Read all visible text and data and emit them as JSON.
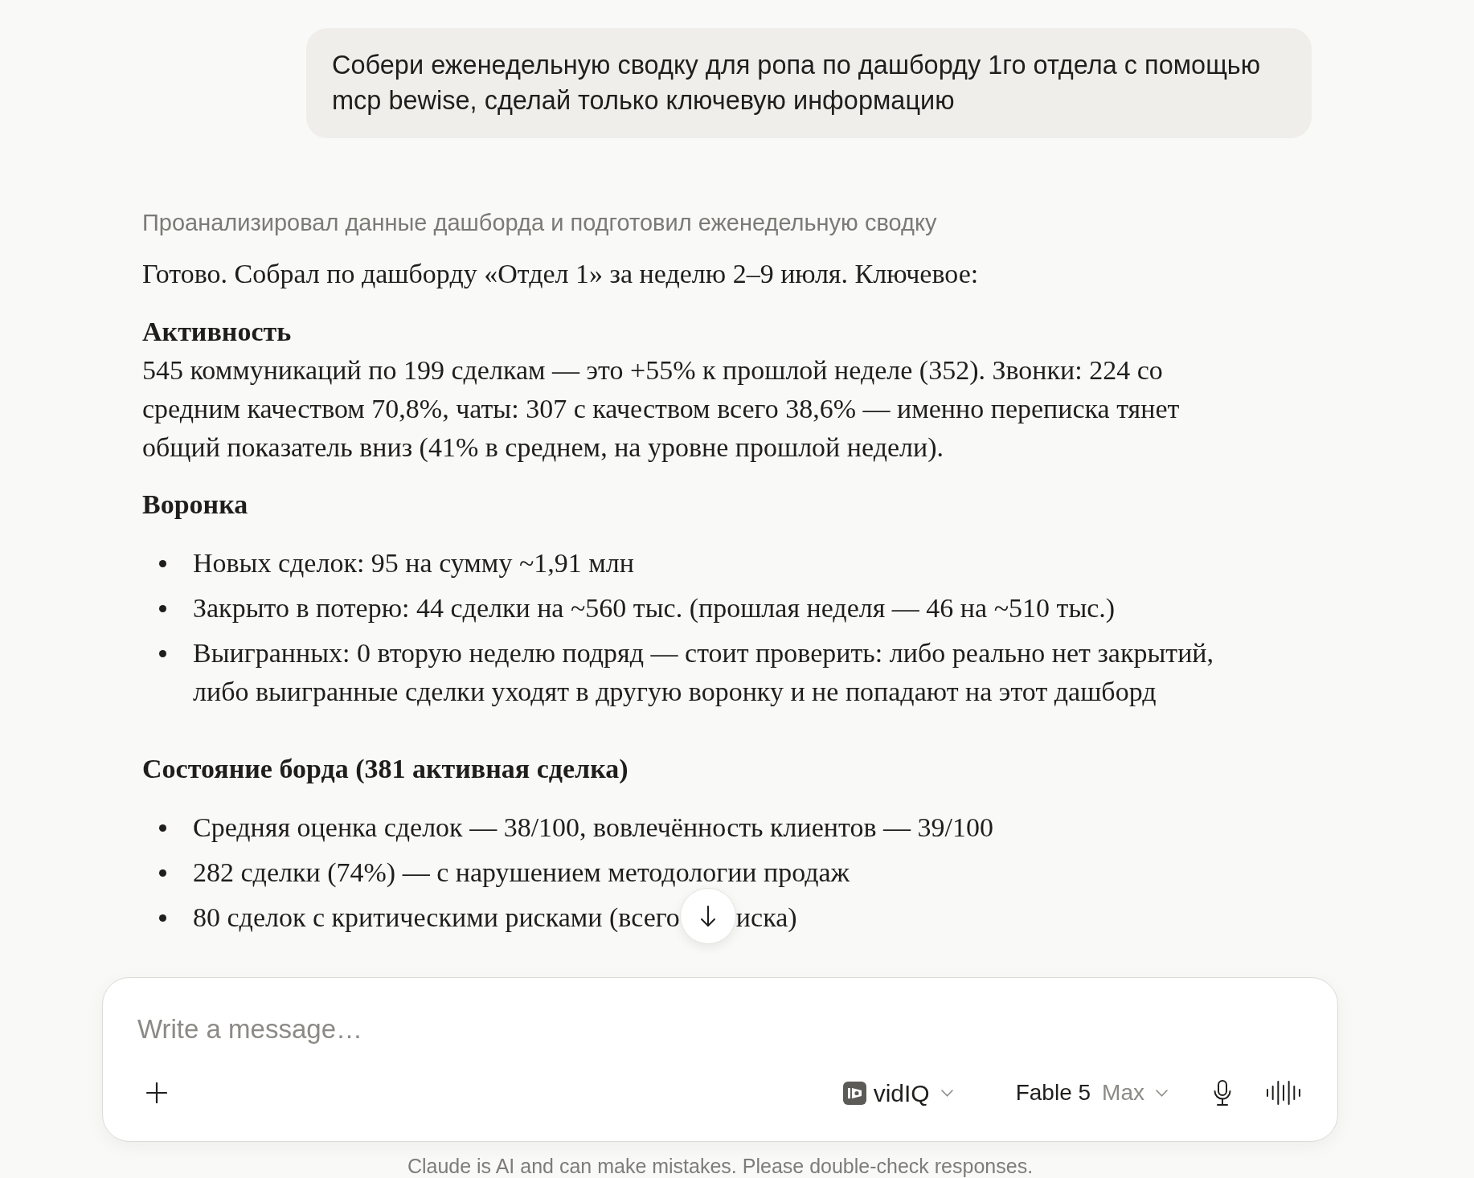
{
  "user_message": {
    "text": "Собери еженедельную сводку для ропа по дашборду 1го отдела с помощью mcp bewise, сделай только ключевую информацию"
  },
  "response": {
    "status": "Проанализировал данные дашборда и подготовил еженедельную сводку",
    "intro": "Готово. Собрал по дашборду «Отдел 1» за неделю 2–9 июля. Ключевое:",
    "sections": [
      {
        "kind": "paragraph",
        "heading": "Активность",
        "text": "545 коммуникаций по 199 сделкам — это +55% к прошлой неделе (352). Звонки: 224 со средним качеством 70,8%, чаты: 307 с качеством всего 38,6% — именно переписка тянет общий показатель вниз (41% в среднем, на уровне прошлой недели)."
      },
      {
        "kind": "list",
        "heading": "Воронка",
        "items": [
          {
            "segments": [
              "Новых сделок: 95 на сумму ~1,91 млн"
            ]
          },
          {
            "segments": [
              "Закрыто в потерю: 44 сделки на ~560 тыс. (прошлая неделя — 46 на ~510 тыс.)"
            ]
          },
          {
            "segments": [
              "Выигранных: 0 вторую неделю подряд — стоит проверить: либо реально нет закрытий, либо выигранные сделки уходят в другую воронку и не попадают на этот дашборд"
            ]
          }
        ]
      },
      {
        "kind": "list",
        "heading": "Состояние борда (381 активная сделка)",
        "items": [
          {
            "segments": [
              "Средняя оценка сделок — 38/100, вовлечённость клиентов — 39/100"
            ]
          },
          {
            "segments": [
              "282 сделки (74%) — с нарушением методологии продаж"
            ]
          },
          {
            "segments": [
              "80 сделок с критическими рисками (всего",
              "иска)"
            ]
          }
        ]
      }
    ]
  },
  "composer": {
    "placeholder": "Write a message…",
    "connector": {
      "label": "vidIQ"
    },
    "model": {
      "name": "Fable 5",
      "effort": "Max"
    }
  },
  "disclaimer": "Claude is AI and can make mistakes. Please double-check responses."
}
